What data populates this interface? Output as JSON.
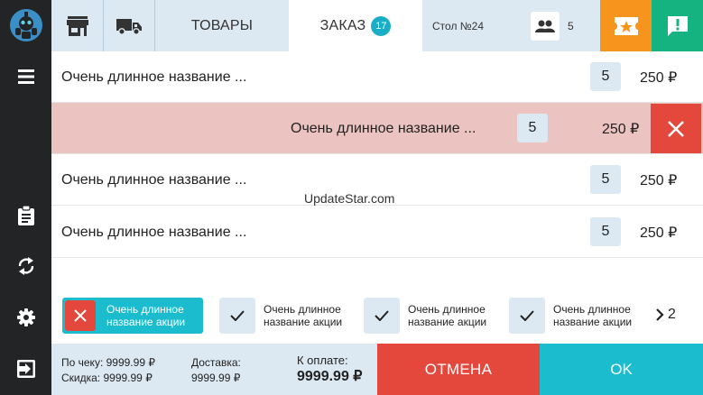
{
  "colors": {
    "sidebar": "#222426",
    "light_blue": "#dce9f3",
    "accent_teal": "#1bbccd",
    "danger_red": "#e4473c",
    "selected_row": "#ebc3c1",
    "orange": "#f7941d",
    "green": "#15b380"
  },
  "sidebar": {
    "items": [
      {
        "icon": "robot-logo-icon"
      },
      {
        "icon": "menu-icon"
      },
      {
        "icon": "clipboard-icon"
      },
      {
        "icon": "sync-icon"
      },
      {
        "icon": "gear-icon"
      },
      {
        "icon": "exit-icon"
      }
    ]
  },
  "topbar": {
    "store_icon": "store-icon",
    "delivery_icon": "truck-icon",
    "goods_tab": "ТОВАРЫ",
    "order_tab": "ЗАКАЗ",
    "order_count": "17",
    "table": "Стол №24",
    "guests_icon": "people-icon",
    "guests": "5",
    "promo_icon": "ticket-star-icon",
    "message_icon": "message-alert-icon"
  },
  "order": {
    "items": [
      {
        "name": "Очень длинное название ...",
        "qty": "5",
        "price": "250 ₽",
        "selected": false
      },
      {
        "name": "Очень длинное название ...",
        "qty": "5",
        "price": "250 ₽",
        "selected": true
      },
      {
        "name": "Очень длинное название ...",
        "qty": "5",
        "price": "250 ₽",
        "selected": false
      },
      {
        "name": "Очень длинное название ...",
        "qty": "5",
        "price": "250 ₽",
        "selected": false
      }
    ]
  },
  "watermark": "UpdateStar.com",
  "promotions": {
    "items": [
      {
        "label": "Очень длинное название акции",
        "active": true
      },
      {
        "label": "Очень длинное название акции",
        "active": false
      },
      {
        "label": "Очень длинное название акции",
        "active": false
      },
      {
        "label": "Очень длинное название акции",
        "active": false
      }
    ],
    "more_count": "2"
  },
  "summary": {
    "check_line": "По чеку: 9999.99 ₽",
    "discount_line": "Скидка: 9999.99 ₽",
    "delivery_label": "Доставка:",
    "delivery_value": "9999.99 ₽",
    "pay_label": "К оплате:",
    "pay_total": "9999.99 ₽"
  },
  "actions": {
    "cancel": "ОТМЕНА",
    "ok": "OK"
  }
}
